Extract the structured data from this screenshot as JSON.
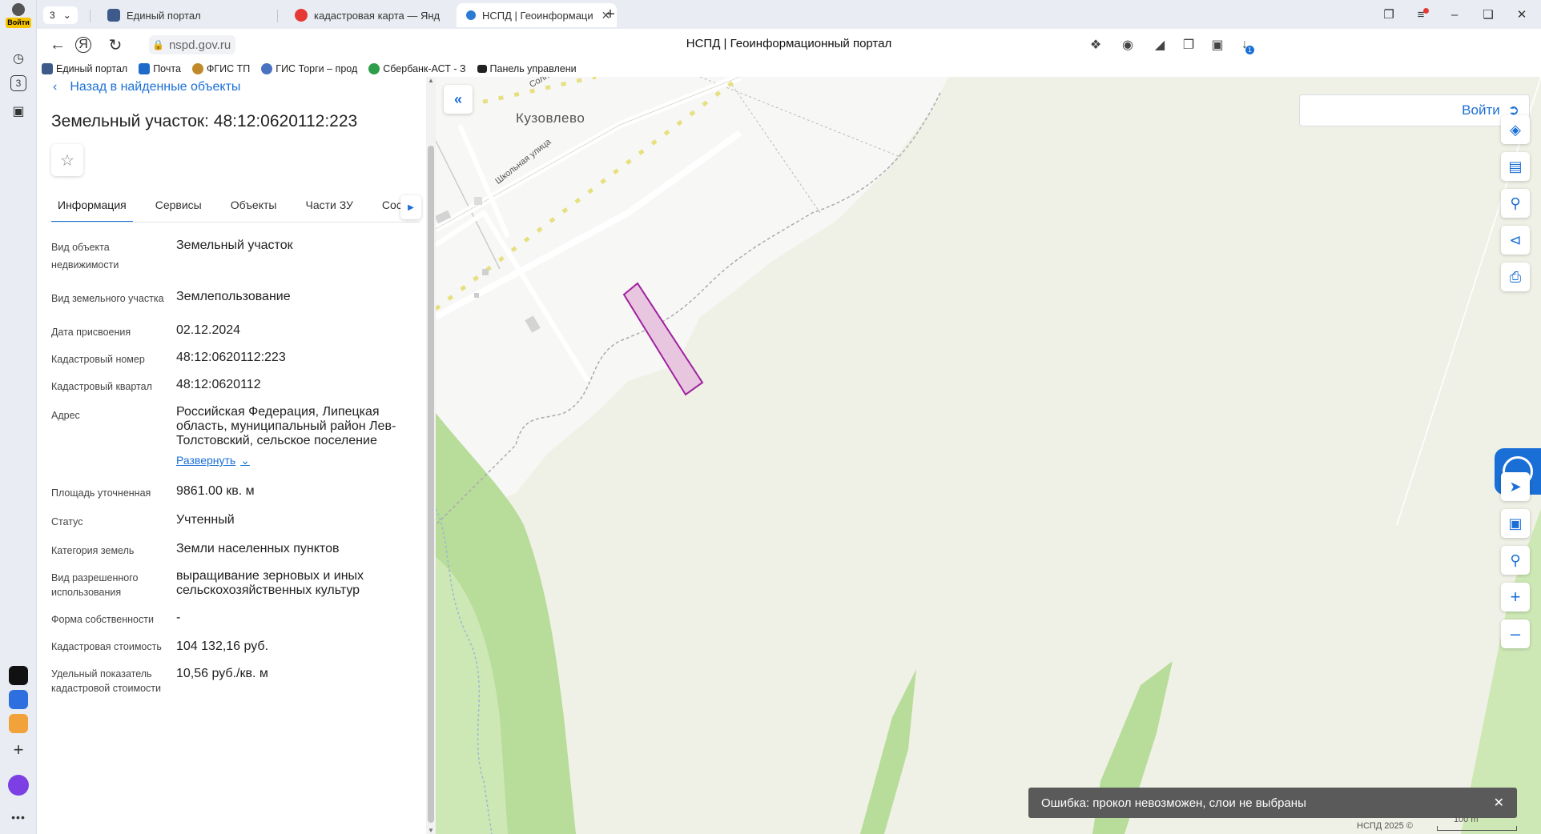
{
  "rail": {
    "avatar_badge": "Войти",
    "tabs_count": "3"
  },
  "browser": {
    "tab_counter": "3",
    "tabs": [
      {
        "title": "Единый портал",
        "favicon_color": "#3d5a8a"
      },
      {
        "title": "кадастровая карта — Янд",
        "favicon_color": "#e53935"
      },
      {
        "title": "НСПД | Геоинформаци",
        "favicon_color": "#2b7bd6"
      }
    ],
    "url": "nspd.gov.ru",
    "page_title": "НСПД | Геоинформационный портал",
    "bookmarks": [
      {
        "label": "Единый портал",
        "color": "#3d5a8a"
      },
      {
        "label": "Почта",
        "color": "#1e6ac8"
      },
      {
        "label": "ФГИС ТП",
        "color": "#c08a2a"
      },
      {
        "label": "ГИС Торги – прод",
        "color": "#4a72c2"
      },
      {
        "label": "Сбербанк-АСТ - З",
        "color": "#2e9e4a"
      },
      {
        "label": "Панель управлени",
        "color": "#222222"
      }
    ],
    "download_badge": "1"
  },
  "panel": {
    "back_label": "Назад в найденные объекты",
    "title": "Земельный участок: 48:12:0620112:223",
    "tabs": [
      {
        "label": "Информация"
      },
      {
        "label": "Сервисы"
      },
      {
        "label": "Объекты"
      },
      {
        "label": "Части ЗУ"
      },
      {
        "label": "Соста"
      }
    ],
    "rows": [
      {
        "key": "Вид объекта недвижимости",
        "value": "Земельный участок"
      },
      {
        "key": "Вид земельного участка",
        "value": "Землепользование"
      },
      {
        "key": "Дата присвоения",
        "value": "02.12.2024"
      },
      {
        "key": "Кадастровый номер",
        "value": "48:12:0620112:223"
      },
      {
        "key": "Кадастровый квартал",
        "value": "48:12:0620112"
      },
      {
        "key": "Адрес",
        "value": "Российская Федерация, Липецкая область, муниципальный район Лев-Толстовский, сельское поселение"
      },
      {
        "key": "Площадь уточненная",
        "value": "9861.00 кв. м"
      },
      {
        "key": "Статус",
        "value": "Учтенный"
      },
      {
        "key": "Категория земель",
        "value": "Земли населенных пунктов"
      },
      {
        "key": "Вид разрешенного использования",
        "value": "выращивание зерновых и иных сельскохозяйственных культур"
      },
      {
        "key": "Форма собственности",
        "value": "-"
      },
      {
        "key": "Кадастровая стоимость",
        "value": "104 132,16 руб."
      },
      {
        "key": "Удельный показатель кадастровой стоимости",
        "value": "10,56 руб./кв. м"
      }
    ],
    "expand_label": "Развернуть"
  },
  "map": {
    "village_label": "Кузовлево",
    "street_1": "Школьная улица",
    "street_2": "Солнечн",
    "login_label": "Войти",
    "toast": "Ошибка: прокол невозможен, слои не выбраны",
    "copyright": "НСПД 2025 ©",
    "scale": "100 m",
    "parcel_color": "#a020a0"
  }
}
